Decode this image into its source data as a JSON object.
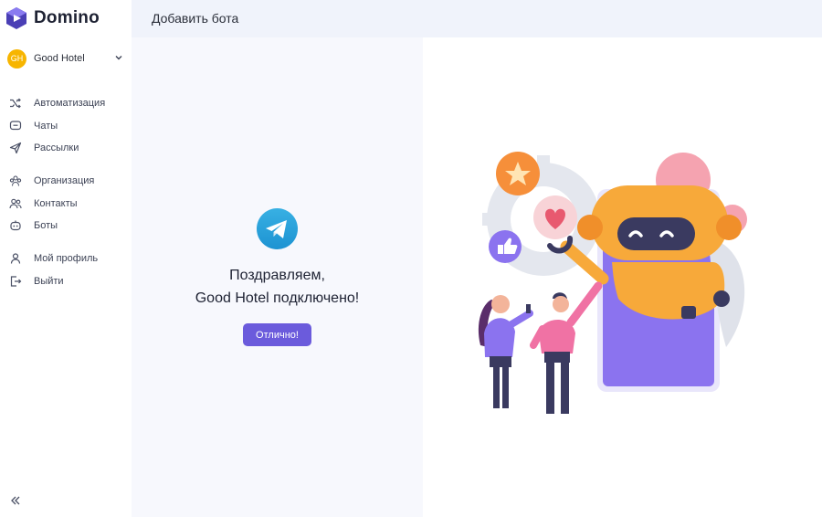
{
  "app": {
    "name": "Domino"
  },
  "org": {
    "initials": "GH",
    "name": "Good Hotel"
  },
  "nav": {
    "automation": "Автоматизация",
    "chats": "Чаты",
    "mailings": "Рассылки",
    "organization": "Организация",
    "contacts": "Контакты",
    "bots": "Боты",
    "profile": "Мой профиль",
    "logout": "Выйти"
  },
  "header": {
    "title": "Добавить бота"
  },
  "main": {
    "congrats_line1": "Поздравляем,",
    "congrats_line2": "Good Hotel подключено!",
    "ok_label": "Отлично!"
  },
  "colors": {
    "accent": "#6b5bdc",
    "telegram": "#2aa3e6",
    "avatar": "#f7b500",
    "header_bg": "#f0f3fb",
    "panel_bg": "#f7f8fd"
  }
}
